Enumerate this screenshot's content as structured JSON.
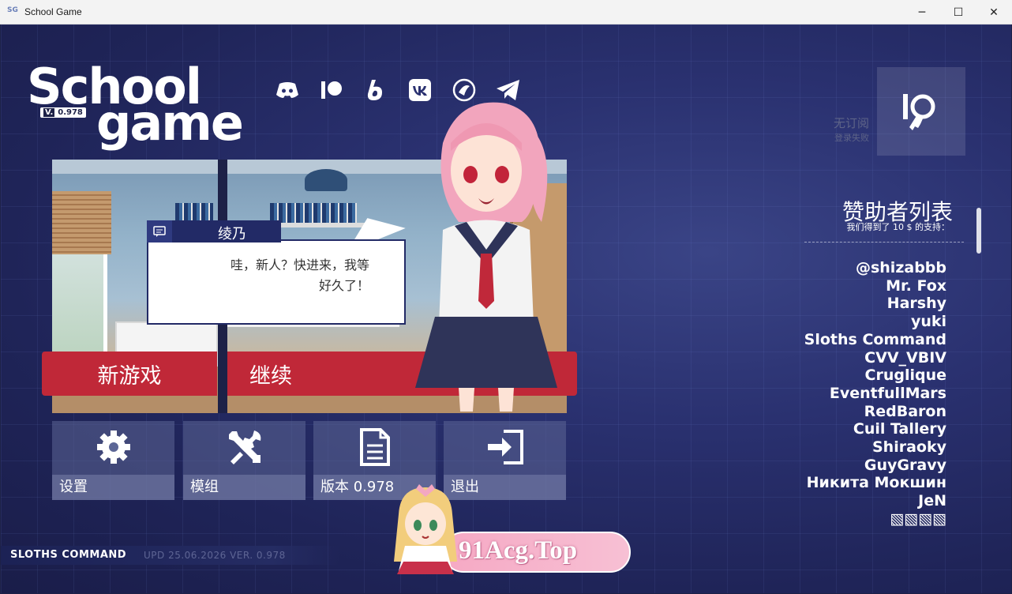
{
  "window": {
    "title": "School Game",
    "icon_text": "SG",
    "controls": {
      "minimize": "─",
      "maximize": "☐",
      "close": "✕"
    }
  },
  "logo": {
    "word1": "School",
    "word2": "game",
    "version_prefix": "V.",
    "version": "0.978"
  },
  "social_icons": [
    "discord-icon",
    "patreon-icon",
    "boosty-icon",
    "vk-icon",
    "sponsor-icon",
    "telegram-icon"
  ],
  "login": {
    "status_line1": "无订阅",
    "status_line2": "登录失败"
  },
  "sponsors": {
    "title": "赞助者列表",
    "subtitle": "我们得到了 10 $ 的支持：",
    "names": [
      "@shizabbb",
      "Mr. Fox",
      "Harshy",
      "yuki",
      "Sloths Command",
      "CVV_VBIV",
      "Cruglique",
      "EventfullMars",
      "RedBaron",
      "Cuil Tallery",
      "Shiraoky",
      "GuyGravy",
      "Никита Мокшин",
      "JeN",
      "▧▧▧▧"
    ]
  },
  "dialog": {
    "speaker": "绫乃",
    "line1": "哇，新人？快进来，我等",
    "line2": "好久了！"
  },
  "buttons": {
    "new_game": "新游戏",
    "continue": "继续"
  },
  "tiles": [
    {
      "label": "设置",
      "icon": "gear-icon"
    },
    {
      "label": "模组",
      "icon": "tools-icon"
    },
    {
      "label": "版本 0.978",
      "icon": "document-icon"
    },
    {
      "label": "退出",
      "icon": "exit-icon"
    }
  ],
  "footer": {
    "studio": "SLOTHS COMMAND",
    "update": "UPD 25.06.2026 VER. 0.978"
  },
  "watermark": {
    "text": "91Acg.Top"
  },
  "colors": {
    "accent_red": "#c02838",
    "background": "#1d2147"
  }
}
